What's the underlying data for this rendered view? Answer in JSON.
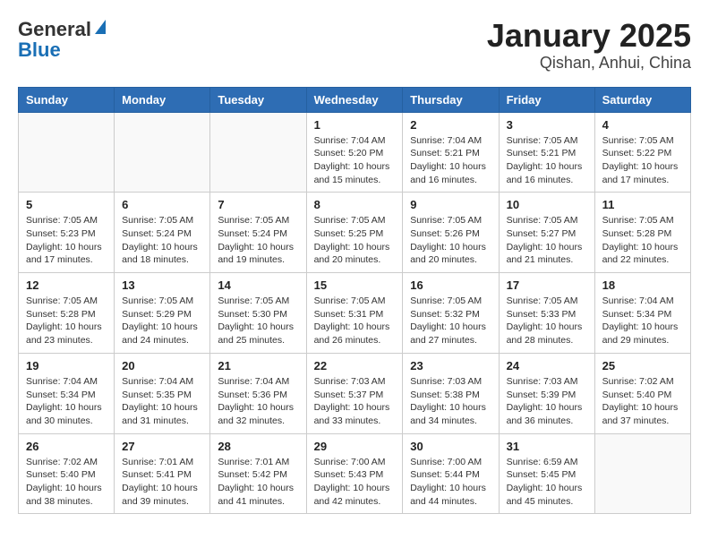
{
  "header": {
    "logo_general": "General",
    "logo_blue": "Blue",
    "month_title": "January 2025",
    "location": "Qishan, Anhui, China"
  },
  "days_of_week": [
    "Sunday",
    "Monday",
    "Tuesday",
    "Wednesday",
    "Thursday",
    "Friday",
    "Saturday"
  ],
  "weeks": [
    [
      {
        "day": "",
        "info": ""
      },
      {
        "day": "",
        "info": ""
      },
      {
        "day": "",
        "info": ""
      },
      {
        "day": "1",
        "info": "Sunrise: 7:04 AM\nSunset: 5:20 PM\nDaylight: 10 hours\nand 15 minutes."
      },
      {
        "day": "2",
        "info": "Sunrise: 7:04 AM\nSunset: 5:21 PM\nDaylight: 10 hours\nand 16 minutes."
      },
      {
        "day": "3",
        "info": "Sunrise: 7:05 AM\nSunset: 5:21 PM\nDaylight: 10 hours\nand 16 minutes."
      },
      {
        "day": "4",
        "info": "Sunrise: 7:05 AM\nSunset: 5:22 PM\nDaylight: 10 hours\nand 17 minutes."
      }
    ],
    [
      {
        "day": "5",
        "info": "Sunrise: 7:05 AM\nSunset: 5:23 PM\nDaylight: 10 hours\nand 17 minutes."
      },
      {
        "day": "6",
        "info": "Sunrise: 7:05 AM\nSunset: 5:24 PM\nDaylight: 10 hours\nand 18 minutes."
      },
      {
        "day": "7",
        "info": "Sunrise: 7:05 AM\nSunset: 5:24 PM\nDaylight: 10 hours\nand 19 minutes."
      },
      {
        "day": "8",
        "info": "Sunrise: 7:05 AM\nSunset: 5:25 PM\nDaylight: 10 hours\nand 20 minutes."
      },
      {
        "day": "9",
        "info": "Sunrise: 7:05 AM\nSunset: 5:26 PM\nDaylight: 10 hours\nand 20 minutes."
      },
      {
        "day": "10",
        "info": "Sunrise: 7:05 AM\nSunset: 5:27 PM\nDaylight: 10 hours\nand 21 minutes."
      },
      {
        "day": "11",
        "info": "Sunrise: 7:05 AM\nSunset: 5:28 PM\nDaylight: 10 hours\nand 22 minutes."
      }
    ],
    [
      {
        "day": "12",
        "info": "Sunrise: 7:05 AM\nSunset: 5:28 PM\nDaylight: 10 hours\nand 23 minutes."
      },
      {
        "day": "13",
        "info": "Sunrise: 7:05 AM\nSunset: 5:29 PM\nDaylight: 10 hours\nand 24 minutes."
      },
      {
        "day": "14",
        "info": "Sunrise: 7:05 AM\nSunset: 5:30 PM\nDaylight: 10 hours\nand 25 minutes."
      },
      {
        "day": "15",
        "info": "Sunrise: 7:05 AM\nSunset: 5:31 PM\nDaylight: 10 hours\nand 26 minutes."
      },
      {
        "day": "16",
        "info": "Sunrise: 7:05 AM\nSunset: 5:32 PM\nDaylight: 10 hours\nand 27 minutes."
      },
      {
        "day": "17",
        "info": "Sunrise: 7:05 AM\nSunset: 5:33 PM\nDaylight: 10 hours\nand 28 minutes."
      },
      {
        "day": "18",
        "info": "Sunrise: 7:04 AM\nSunset: 5:34 PM\nDaylight: 10 hours\nand 29 minutes."
      }
    ],
    [
      {
        "day": "19",
        "info": "Sunrise: 7:04 AM\nSunset: 5:34 PM\nDaylight: 10 hours\nand 30 minutes."
      },
      {
        "day": "20",
        "info": "Sunrise: 7:04 AM\nSunset: 5:35 PM\nDaylight: 10 hours\nand 31 minutes."
      },
      {
        "day": "21",
        "info": "Sunrise: 7:04 AM\nSunset: 5:36 PM\nDaylight: 10 hours\nand 32 minutes."
      },
      {
        "day": "22",
        "info": "Sunrise: 7:03 AM\nSunset: 5:37 PM\nDaylight: 10 hours\nand 33 minutes."
      },
      {
        "day": "23",
        "info": "Sunrise: 7:03 AM\nSunset: 5:38 PM\nDaylight: 10 hours\nand 34 minutes."
      },
      {
        "day": "24",
        "info": "Sunrise: 7:03 AM\nSunset: 5:39 PM\nDaylight: 10 hours\nand 36 minutes."
      },
      {
        "day": "25",
        "info": "Sunrise: 7:02 AM\nSunset: 5:40 PM\nDaylight: 10 hours\nand 37 minutes."
      }
    ],
    [
      {
        "day": "26",
        "info": "Sunrise: 7:02 AM\nSunset: 5:40 PM\nDaylight: 10 hours\nand 38 minutes."
      },
      {
        "day": "27",
        "info": "Sunrise: 7:01 AM\nSunset: 5:41 PM\nDaylight: 10 hours\nand 39 minutes."
      },
      {
        "day": "28",
        "info": "Sunrise: 7:01 AM\nSunset: 5:42 PM\nDaylight: 10 hours\nand 41 minutes."
      },
      {
        "day": "29",
        "info": "Sunrise: 7:00 AM\nSunset: 5:43 PM\nDaylight: 10 hours\nand 42 minutes."
      },
      {
        "day": "30",
        "info": "Sunrise: 7:00 AM\nSunset: 5:44 PM\nDaylight: 10 hours\nand 44 minutes."
      },
      {
        "day": "31",
        "info": "Sunrise: 6:59 AM\nSunset: 5:45 PM\nDaylight: 10 hours\nand 45 minutes."
      },
      {
        "day": "",
        "info": ""
      }
    ]
  ]
}
